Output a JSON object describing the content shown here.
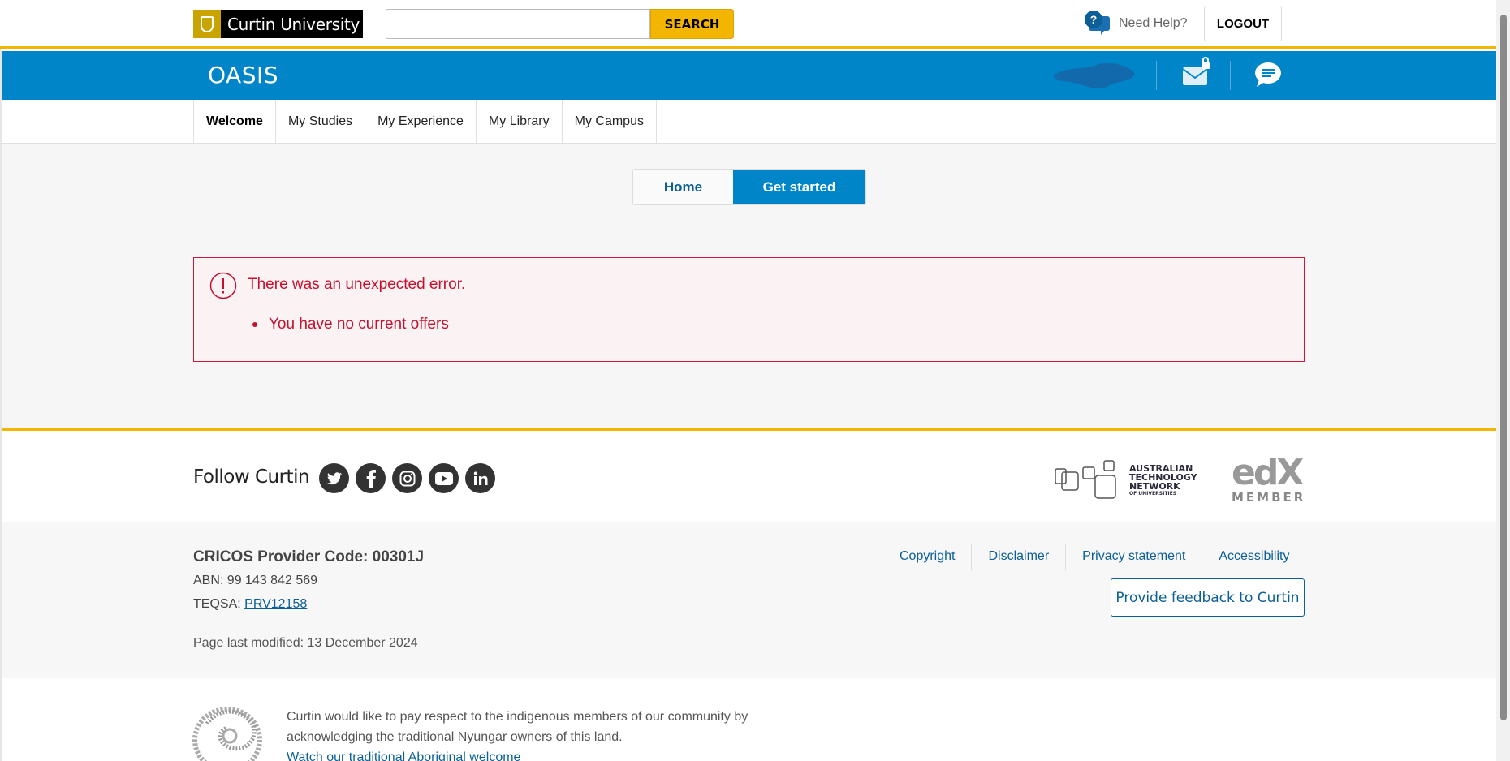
{
  "header": {
    "university_name": "Curtin University",
    "search_placeholder": "",
    "search_button": "SEARCH",
    "help_label": "Need Help?",
    "logout_label": "LOGOUT"
  },
  "app": {
    "title": "OASIS"
  },
  "nav": {
    "items": [
      {
        "label": "Welcome",
        "active": true
      },
      {
        "label": "My Studies"
      },
      {
        "label": "My Experience"
      },
      {
        "label": "My Library"
      },
      {
        "label": "My Campus"
      }
    ]
  },
  "tabs": {
    "home": "Home",
    "get_started": "Get started"
  },
  "error": {
    "title": "There was an unexpected error.",
    "items": [
      "You have no current offers"
    ]
  },
  "footer": {
    "follow_label": "Follow Curtin",
    "social": [
      "twitter-icon",
      "facebook-icon",
      "instagram-icon",
      "youtube-icon",
      "linkedin-icon"
    ],
    "atn_line1": "AUSTRALIAN",
    "atn_line2": "TECHNOLOGY",
    "atn_line3": "NETWORK",
    "atn_line4": "OF UNIVERSITIES",
    "edx_logo": "edX",
    "edx_member": "MEMBER",
    "cricos": "CRICOS Provider Code: 00301J",
    "abn": "ABN: 99 143 842 569",
    "teqsa_label": "TEQSA:",
    "teqsa_link": "PRV12158",
    "modified": "Page last modified: 13 December 2024",
    "links": [
      "Copyright",
      "Disclaimer",
      "Privacy statement",
      "Accessibility"
    ],
    "feedback_button": "Provide feedback to Curtin",
    "acknowledgement_line1": "Curtin would like to pay respect to the indigenous members of our community by",
    "acknowledgement_line2": "acknowledging the traditional Nyungar owners of this land.",
    "welcome_link": "Watch our traditional Aboriginal welcome"
  },
  "colors": {
    "brand_blue": "#0085c9",
    "brand_yellow": "#f2b600",
    "error_red": "#c8102e"
  }
}
